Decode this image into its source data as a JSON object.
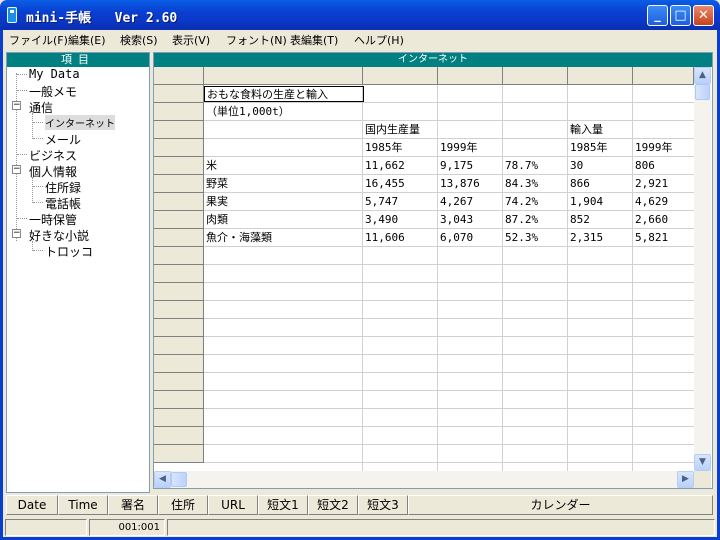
{
  "window": {
    "title": "mini-手帳   Ver 2.60",
    "min_glyph": "_",
    "max_glyph": "□",
    "close_glyph": "✕"
  },
  "menu": {
    "items": [
      "ファイル(F)",
      "編集(E)",
      "検索(S)",
      "表示(V)",
      "フォント(N)",
      "表編集(T)",
      "ヘルプ(H)"
    ]
  },
  "tree": {
    "header": "項目",
    "nodes": [
      {
        "label": "My Data",
        "expander": ""
      },
      {
        "label": "一般メモ",
        "expander": ""
      },
      {
        "label": "通信",
        "expander": "−"
      },
      {
        "label": "インターネット",
        "expander": ""
      },
      {
        "label": "メール",
        "expander": ""
      },
      {
        "label": "ビジネス",
        "expander": ""
      },
      {
        "label": "個人情報",
        "expander": "−"
      },
      {
        "label": "住所録",
        "expander": ""
      },
      {
        "label": "電話帳",
        "expander": ""
      },
      {
        "label": "一時保管",
        "expander": ""
      },
      {
        "label": "好きな小説",
        "expander": "−"
      },
      {
        "label": "トロッコ",
        "expander": ""
      }
    ]
  },
  "grid": {
    "header": "インターネット",
    "rows": [
      [
        "おもな食料の生産と輸入",
        "",
        "",
        "",
        "",
        ""
      ],
      [
        "（単位1,000t）",
        "",
        "",
        "",
        "",
        ""
      ],
      [
        "",
        "国内生産量",
        "",
        "",
        "輸入量",
        ""
      ],
      [
        "",
        "1985年",
        "1999年",
        "",
        "1985年",
        "1999年"
      ],
      [
        "米",
        "11,662",
        "9,175",
        "78.7%",
        "30",
        "806"
      ],
      [
        "野菜",
        "16,455",
        "13,876",
        "84.3%",
        "866",
        "2,921"
      ],
      [
        "果実",
        "5,747",
        "4,267",
        "74.2%",
        "1,904",
        "4,629"
      ],
      [
        "肉類",
        "3,490",
        "3,043",
        "87.2%",
        "852",
        "2,660"
      ],
      [
        "魚介・海藻類",
        "11,606",
        "6,070",
        "52.3%",
        "2,315",
        "5,821"
      ]
    ]
  },
  "scrollbars": {
    "up": "▲",
    "down": "▼",
    "left": "◀",
    "right": "▶"
  },
  "toolbar": {
    "buttons": [
      "Date",
      "Time",
      "署名",
      "住所",
      "URL",
      "短文1",
      "短文2",
      "短文3",
      "カレンダー"
    ]
  },
  "statusbar": {
    "position": "001:001"
  },
  "colors": {
    "titlebar": "#0a3ed1",
    "pane_header": "#008080",
    "chrome": "#ece9d8"
  }
}
